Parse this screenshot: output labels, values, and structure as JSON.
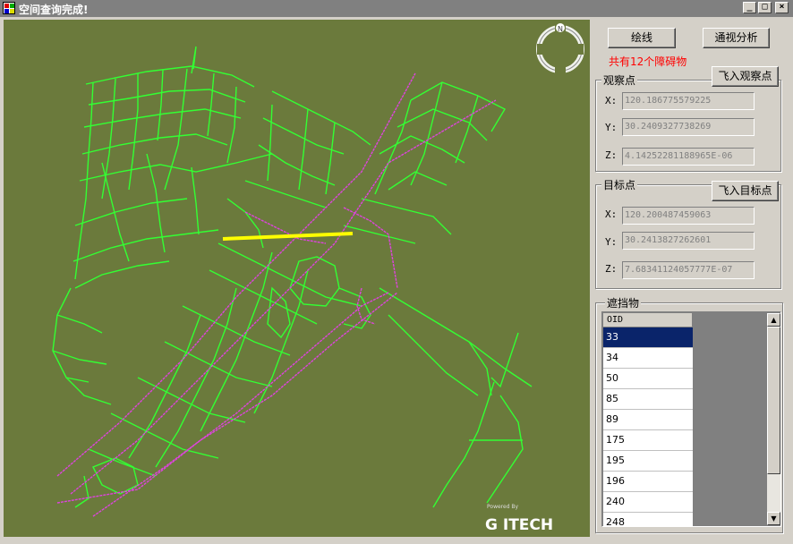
{
  "window": {
    "title": "空间查询完成!",
    "minimize_glyph": "_",
    "maximize_glyph": "□",
    "close_glyph": "×"
  },
  "map": {
    "compass_label": "N",
    "watermark_small": "Powered By",
    "watermark_brand": "G ITECH",
    "colors": {
      "background": "#6b7a3c",
      "roads": "#33ff33",
      "boundaries": "#dd44dd",
      "sight_line": "#ffff00"
    }
  },
  "toolbar": {
    "draw_line_label": "绘线",
    "visibility_label": "通视分析",
    "obstacle_notice": "共有12个障碍物"
  },
  "observer": {
    "group_title": "观察点",
    "fly_button": "飞入观察点",
    "x_label": "X:",
    "y_label": "Y:",
    "z_label": "Z:",
    "x_value": "120.186775579225",
    "y_value": "30.2409327738269",
    "z_value": "4.14252281188965E-06"
  },
  "target": {
    "group_title": "目标点",
    "fly_button": "飞入目标点",
    "x_label": "X:",
    "y_label": "Y:",
    "z_label": "Z:",
    "x_value": "120.200487459063",
    "y_value": "30.2413827262601",
    "z_value": "7.68341124057777E-07"
  },
  "obstacles": {
    "group_title": "遮挡物",
    "column_header": "OID",
    "rows": [
      "33",
      "34",
      "50",
      "85",
      "89",
      "175",
      "195",
      "196",
      "240",
      "248"
    ],
    "selected_row": 0
  }
}
